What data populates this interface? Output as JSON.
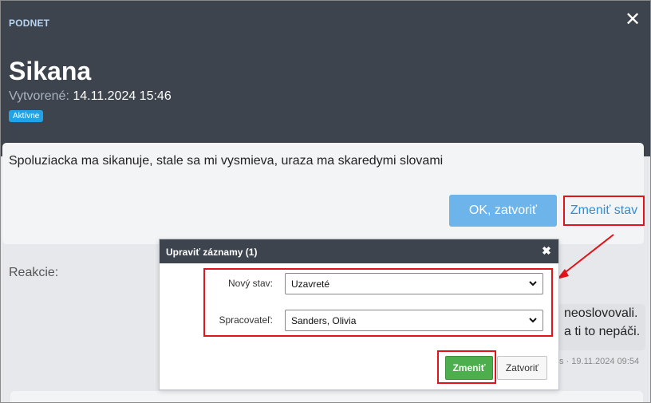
{
  "header": {
    "section_label": "PODNET",
    "title": "Sikana",
    "created_label": "Vytvorené:",
    "created_value": "14.11.2024 15:46",
    "status_badge": "Aktívne"
  },
  "card": {
    "description": "Spoluziacka ma sikanuje, stale sa mi vysmieva, uraza ma skaredymi slovami",
    "ok_button": "OK, zatvoriť",
    "change_state_button": "Zmeniť stav"
  },
  "reactions": {
    "label": "Reakcie:",
    "comment_line1": "neoslovovali.",
    "comment_line2": "a ti to nepáči.",
    "comment_meta": "s · 19.11.2024 09:54"
  },
  "dialog": {
    "title": "Upraviť záznamy (1)",
    "close_icon": "close-icon",
    "fields": [
      {
        "label": "Nový stav:",
        "value": "Uzavreté"
      },
      {
        "label": "Spracovateľ:",
        "value": "Sanders, Olivia"
      }
    ],
    "submit_button": "Zmeniť",
    "close_button": "Zatvoriť"
  },
  "colors": {
    "header_bg": "#3d444d",
    "badge": "#1fa3e6",
    "ok_button": "#6cb4ea",
    "link": "#2d8fd6",
    "highlight_red": "#e0141a",
    "submit_green": "#4cae4c"
  }
}
